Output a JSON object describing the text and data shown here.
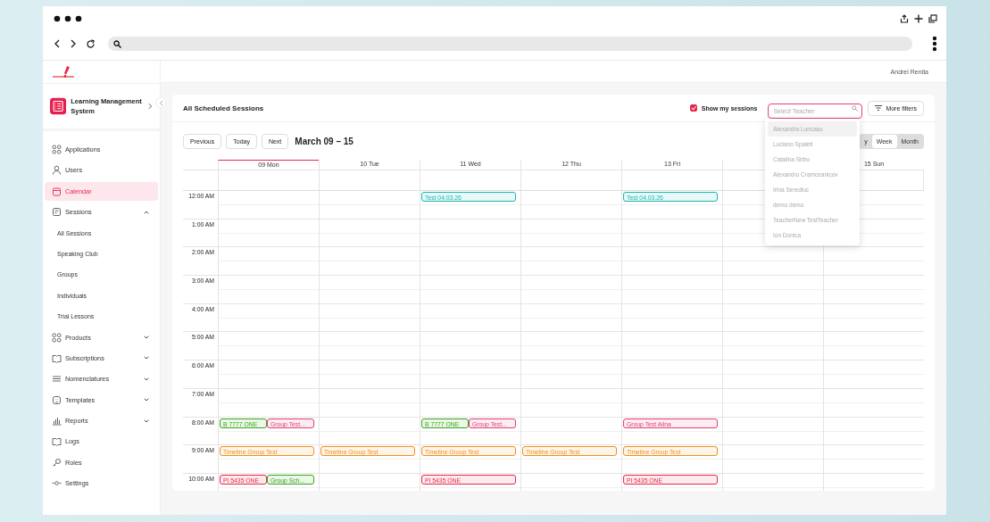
{
  "header": {
    "user": "Andrei Renita"
  },
  "brand": {
    "title": "Learning Management System"
  },
  "sidebar": {
    "items": [
      {
        "label": "Applications",
        "selected": false
      },
      {
        "label": "Users",
        "selected": false
      },
      {
        "label": "Calendar",
        "selected": true
      },
      {
        "label": "Sessions",
        "selected": false,
        "expanded": true,
        "children": [
          {
            "label": "All Sessions"
          },
          {
            "label": "Speaking Club"
          },
          {
            "label": "Groups"
          },
          {
            "label": "Individuals"
          },
          {
            "label": "Trial Lessons"
          }
        ]
      },
      {
        "label": "Products",
        "selected": false,
        "expanded": false
      },
      {
        "label": "Subscriptions",
        "selected": false,
        "expanded": false
      },
      {
        "label": "Nomenclatures",
        "selected": false,
        "expanded": false
      },
      {
        "label": "Templates",
        "selected": false,
        "expanded": false
      },
      {
        "label": "Reports",
        "selected": false,
        "expanded": false
      },
      {
        "label": "Logs",
        "selected": false
      },
      {
        "label": "Roles",
        "selected": false
      },
      {
        "label": "Settings",
        "selected": false
      }
    ]
  },
  "card": {
    "title": "All Scheduled Sessions",
    "show_my_sessions": {
      "label": "Show my sessions",
      "checked": true
    },
    "teacher_select": {
      "placeholder": "Select Teacher",
      "options": [
        {
          "label": "Alexandra Luncasu",
          "highlighted": true
        },
        {
          "label": "Luciano Spaleti",
          "highlighted": false
        },
        {
          "label": "Catalina Sirbu",
          "highlighted": false
        },
        {
          "label": "Alexandru Cramceanicov",
          "highlighted": false
        },
        {
          "label": "Irina Serediuc",
          "highlighted": false
        },
        {
          "label": "demo demo",
          "highlighted": false
        },
        {
          "label": "TeacherNew TestTeacher",
          "highlighted": false
        },
        {
          "label": "Ion Donica",
          "highlighted": false
        }
      ]
    },
    "more_filters": "More filters"
  },
  "toolbar": {
    "buttons": [
      "Previous",
      "Today",
      "Next"
    ],
    "range": "March 09 – 15",
    "views": [
      {
        "label": "y",
        "selected": false
      },
      {
        "label": "Week",
        "selected": true
      },
      {
        "label": "Month",
        "selected": false
      }
    ]
  },
  "calendar": {
    "days": [
      {
        "label": "09 Mon",
        "today": true
      },
      {
        "label": "10 Tue",
        "today": false
      },
      {
        "label": "11 Wed",
        "today": false
      },
      {
        "label": "12 Thu",
        "today": false
      },
      {
        "label": "13 Fri",
        "today": false
      },
      {
        "today": false
      },
      {
        "label": "15 Sun",
        "today": false
      }
    ],
    "hours": [
      {
        "label": "12:00 AM",
        "slots": [
          {
            "kind": "empty"
          },
          {
            "kind": "empty"
          },
          {
            "kind": "events",
            "events": [
              {
                "title": "Test 04.03.26",
                "color": "#17b8b0"
              }
            ]
          },
          {
            "kind": "empty"
          },
          {
            "kind": "events",
            "events": [
              {
                "title": "Test 04.03.26",
                "color": "#17b8b0"
              }
            ]
          },
          {
            "kind": "empty"
          },
          {
            "kind": "empty"
          }
        ]
      },
      {
        "label": "1:00 AM"
      },
      {
        "label": "2:00 AM"
      },
      {
        "label": "3:00 AM"
      },
      {
        "label": "4:00 AM"
      },
      {
        "label": "5:00 AM"
      },
      {
        "label": "6:00 AM"
      },
      {
        "label": "7:00 AM"
      },
      {
        "label": "8:00 AM",
        "slots": [
          {
            "kind": "events",
            "events": [
              {
                "title": "B 7777 ONE",
                "color": "#3aa51c"
              },
              {
                "title": "Group Test...",
                "color": "#e0407a"
              }
            ]
          },
          {
            "kind": "empty"
          },
          {
            "kind": "events",
            "events": [
              {
                "title": "B 7777 ONE",
                "color": "#3aa51c"
              },
              {
                "title": "Group Test...",
                "color": "#e0407a"
              }
            ]
          },
          {
            "kind": "empty"
          },
          {
            "kind": "events",
            "events": [
              {
                "title": "Group Test Alina",
                "color": "#e0407a"
              }
            ]
          },
          {
            "kind": "empty"
          },
          {
            "kind": "empty"
          }
        ]
      },
      {
        "label": "9:00 AM",
        "slots": [
          {
            "kind": "events",
            "events": [
              {
                "title": "Timeline Group Test",
                "color": "#f0901e"
              }
            ]
          },
          {
            "kind": "events",
            "events": [
              {
                "title": "Timeline Group Test",
                "color": "#f0901e"
              }
            ]
          },
          {
            "kind": "events",
            "events": [
              {
                "title": "Timeline Group Test",
                "color": "#f0901e"
              }
            ]
          },
          {
            "kind": "events",
            "events": [
              {
                "title": "Timeline Group Test",
                "color": "#f0901e"
              }
            ]
          },
          {
            "kind": "events",
            "events": [
              {
                "title": "Timeline Group Test",
                "color": "#f0901e"
              }
            ]
          },
          {
            "kind": "empty"
          },
          {
            "kind": "empty"
          }
        ]
      },
      {
        "label": "10:00 AM",
        "slots": [
          {
            "kind": "events",
            "events": [
              {
                "title": "PI 5435 ONE",
                "color": "#e8284a"
              },
              {
                "title": "Group Sch...",
                "color": "#3aa51c"
              }
            ]
          },
          {
            "kind": "empty"
          },
          {
            "kind": "events",
            "events": [
              {
                "title": "PI 5435 ONE",
                "color": "#e8284a"
              }
            ]
          },
          {
            "kind": "empty"
          },
          {
            "kind": "events",
            "events": [
              {
                "title": "PI 5435 ONE",
                "color": "#e8284a"
              }
            ]
          },
          {
            "kind": "empty"
          },
          {
            "kind": "empty"
          }
        ]
      }
    ]
  }
}
